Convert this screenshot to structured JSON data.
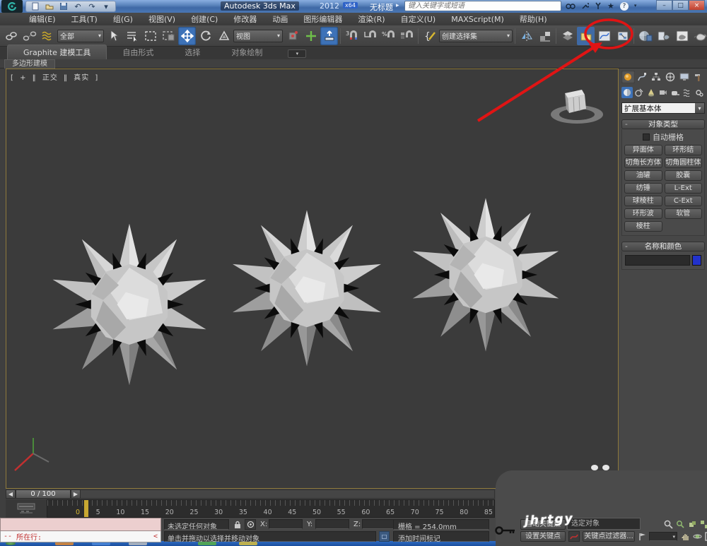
{
  "window": {
    "app_title": "Autodesk 3ds Max",
    "year": "2012",
    "arch": "x64",
    "doc_title": "无标题",
    "search_placeholder": "键入关键字或短语",
    "minimize_glyph": "–",
    "maximize_glyph": "□",
    "close_glyph": "×",
    "help_glyph": "?",
    "star_glyph": "★",
    "expand_glyph": "▸"
  },
  "glyphs": {
    "chevron": "▾",
    "left_arrow": "◀",
    "right_arrow": "▶",
    "minus": "-",
    "undo": "↶",
    "redo": "↷"
  },
  "menus": [
    "编辑(E)",
    "工具(T)",
    "组(G)",
    "视图(V)",
    "创建(C)",
    "修改器",
    "动画",
    "图形编辑器",
    "渲染(R)",
    "自定义(U)",
    "MAXScript(M)",
    "帮助(H)"
  ],
  "toolbar": {
    "selection_filter": "全部",
    "coord_system": "视图",
    "named_sets": "创建选择集",
    "snap_count": "3",
    "percent": "%",
    "brace": "{"
  },
  "ribbon": {
    "tabs": [
      "Graphite 建模工具",
      "自由形式",
      "选择",
      "对象绘制"
    ],
    "subtab": "多边形建模"
  },
  "viewport": {
    "label_plus": "+",
    "label_view": "正交",
    "label_shading": "真实",
    "bracket_l": "[",
    "bracket_r": "]",
    "divider": "‖"
  },
  "command_panel": {
    "category_dropdown": "扩展基本体",
    "object_type": {
      "title": "对象类型",
      "autogrid_label": "自动栅格",
      "buttons": [
        "异面体",
        "环形结",
        "切角长方体",
        "切角圆柱体",
        "油罐",
        "胶囊",
        "纺锤",
        "L-Ext",
        "球棱柱",
        "C-Ext",
        "环形波",
        "软管",
        "棱柱"
      ]
    },
    "name_color": {
      "title": "名称和颜色",
      "name_value": ""
    }
  },
  "timeline": {
    "frame_display": "0 / 100",
    "ticks": [
      "0",
      "5",
      "10",
      "15",
      "20",
      "25",
      "30",
      "35",
      "40",
      "45",
      "50",
      "55",
      "60",
      "65",
      "70",
      "75",
      "80",
      "85"
    ]
  },
  "status_bar": {
    "listener_prefix": "--",
    "listener_line": "所在行:",
    "listener_caret": "<",
    "status_text": "未选定任何对象",
    "prompt_text": "单击并拖动以选择并移动对象",
    "x_label": "X:",
    "y_label": "Y:",
    "z_label": "Z:",
    "grid_text": "栅格 = 254.0mm",
    "add_time_tag": "添加时间标记",
    "auto_key": "自动关键点",
    "set_key": "设置关键点",
    "selected_label": "选定对象",
    "key_filters": "关键点过滤器...",
    "watermark": "jhrtgy"
  },
  "colors": {
    "annotation_red": "#e01414",
    "swatch_blue": "#2232cc",
    "active_blue": "#3d72b8",
    "taskbar_blue": "#2f6cc4",
    "marker_yellow": "#c8a832"
  }
}
